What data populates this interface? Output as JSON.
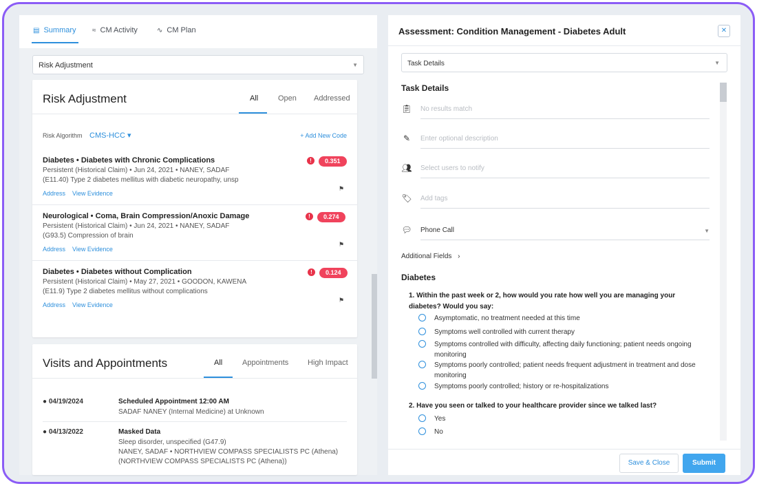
{
  "tabs": [
    {
      "label": "Summary",
      "icon": "summary-icon"
    },
    {
      "label": "CM Activity",
      "icon": "activity-icon"
    },
    {
      "label": "CM Plan",
      "icon": "plan-icon"
    }
  ],
  "left_select": {
    "value": "Risk Adjustment"
  },
  "risk": {
    "title": "Risk Adjustment",
    "subtabs": [
      "All",
      "Open",
      "Addressed"
    ],
    "algo_label": "Risk Algorithm",
    "algo_value": "CMS-HCC ▾",
    "add_code": "+ Add New Code",
    "items": [
      {
        "title": "Diabetes • Diabetes with Chronic Complications",
        "line1": "Persistent (Historical Claim) • Jun 24, 2021 • NANEY, SADAF",
        "line2": "(E11.40) Type 2 diabetes mellitus with diabetic neuropathy, unsp",
        "score": "0.351",
        "link1": "Address",
        "link2": "View Evidence"
      },
      {
        "title": "Neurological • Coma, Brain Compression/Anoxic Damage",
        "line1": "Persistent (Historical Claim) • Jun 24, 2021 • NANEY, SADAF",
        "line2": "(G93.5) Compression of brain",
        "score": "0.274",
        "link1": "Address",
        "link2": "View Evidence"
      },
      {
        "title": "Diabetes • Diabetes without Complication",
        "line1": "Persistent (Historical Claim) • May 27, 2021 • GOODON, KAWENA",
        "line2": "(E11.9) Type 2 diabetes mellitus without complications",
        "score": "0.124",
        "link1": "Address",
        "link2": "View Evidence"
      }
    ]
  },
  "visits": {
    "title": "Visits and Appointments",
    "subtabs": [
      "All",
      "Appointments",
      "High Impact"
    ],
    "items": [
      {
        "date": "04/19/2024",
        "main": "Scheduled Appointment 12:00 AM",
        "sub1": "SADAF NANEY (Internal Medicine) at Unknown"
      },
      {
        "date": "04/13/2022",
        "main": "Masked Data",
        "sub1": "Sleep disorder, unspecified (G47.9)",
        "sub2": "NANEY, SADAF • NORTHVIEW COMPASS SPECIALISTS PC (Athena)",
        "sub3": "(NORTHVIEW COMPASS SPECIALISTS PC (Athena))"
      }
    ]
  },
  "assessment": {
    "title": "Assessment: Condition Management - Diabetes Adult",
    "select_value": "Task Details",
    "section_task": "Task Details",
    "fields": [
      {
        "icon": "clipboard-icon",
        "placeholder": "No results match"
      },
      {
        "icon": "pencil-icon",
        "placeholder": "Enter optional description"
      },
      {
        "icon": "users-icon",
        "placeholder": "Select users to notify"
      },
      {
        "icon": "tag-icon",
        "placeholder": "Add tags"
      },
      {
        "icon": "chat-icon",
        "value": "Phone Call"
      }
    ],
    "additional_fields": "Additional Fields",
    "section_diabetes": "Diabetes",
    "q1": "1. Within the past week or 2, how would you rate how well you are managing your diabetes? Would you say:",
    "q1_options": [
      "Asymptomatic, no treatment needed at this time",
      "Symptoms well controlled with current therapy",
      "Symptoms controlled with difficulty, affecting daily functioning; patient needs ongoing monitoring",
      "Symptoms poorly controlled; patient needs frequent adjustment in treatment and dose monitoring",
      "Symptoms poorly controlled; history or re-hospitalizations"
    ],
    "q2": "2. Have you seen or talked to your healthcare provider since we talked last?",
    "q2_options": [
      "Yes",
      "No"
    ],
    "save_close": "Save & Close",
    "submit": "Submit"
  },
  "colors": {
    "accent": "#2d8fdc",
    "score_badge": "#f0435c",
    "frame": "#8b5cf6"
  }
}
